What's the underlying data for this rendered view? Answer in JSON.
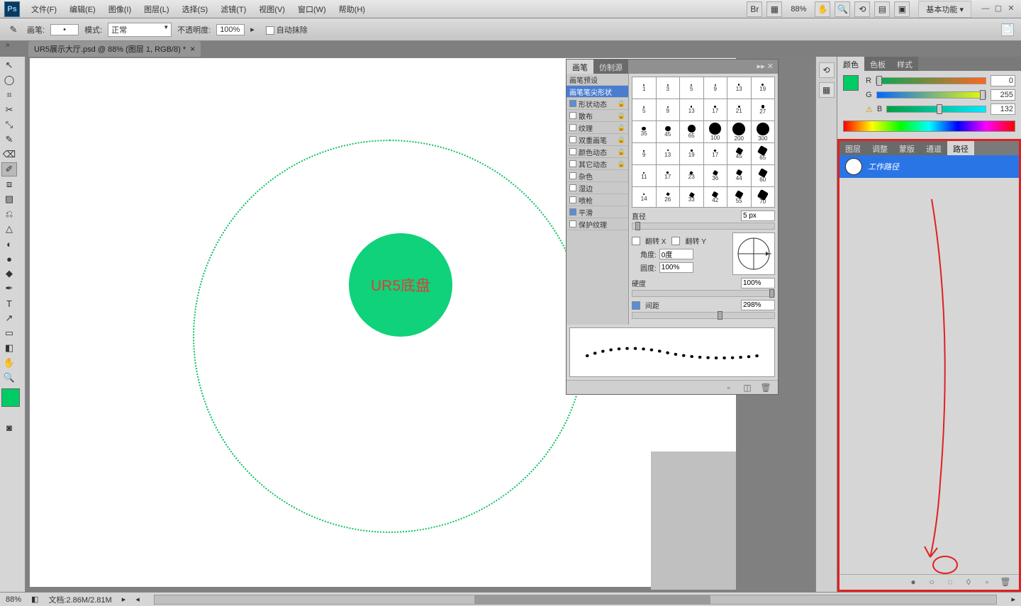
{
  "menubar": {
    "items": [
      "文件(F)",
      "编辑(E)",
      "图像(I)",
      "图层(L)",
      "选择(S)",
      "滤镜(T)",
      "视图(V)",
      "窗口(W)",
      "帮助(H)"
    ],
    "zoom": "88%",
    "workspace": "基本功能"
  },
  "options": {
    "brush_label": "画笔:",
    "mode_label": "模式:",
    "mode_value": "正常",
    "opacity_label": "不透明度:",
    "opacity_value": "100%",
    "auto_erase": "自动抹除"
  },
  "doc_tab": "UR5展示大厅.psd @ 88% (图层 1, RGB/8) *",
  "canvas": {
    "circle_text": "UR5底盘"
  },
  "color_panel": {
    "tabs": [
      "颜色",
      "色板",
      "样式"
    ],
    "r": "0",
    "g": "255",
    "b": "132"
  },
  "paths_panel": {
    "tabs": [
      "图层",
      "调整",
      "蒙版",
      "通道",
      "路径"
    ],
    "item": "工作路径"
  },
  "brush_panel": {
    "tabs": [
      "画笔",
      "仿制源"
    ],
    "section0": "画笔预设",
    "section1": "画笔笔尖形状",
    "opts": [
      "形状动态",
      "散布",
      "纹理",
      "双重画笔",
      "颜色动态",
      "其它动态",
      "杂色",
      "湿边",
      "喷枪",
      "平滑",
      "保护纹理"
    ],
    "tips": [
      1,
      3,
      5,
      9,
      13,
      19,
      5,
      9,
      13,
      17,
      21,
      27,
      35,
      45,
      65,
      100,
      200,
      300,
      9,
      13,
      19,
      17,
      45,
      65,
      11,
      17,
      23,
      36,
      44,
      60,
      14,
      26,
      33,
      42,
      55,
      70
    ],
    "diameter_label": "直径",
    "diameter_value": "5 px",
    "flip_x": "翻转 X",
    "flip_y": "翻转 Y",
    "angle_label": "角度:",
    "angle_value": "0度",
    "round_label": "圆度:",
    "round_value": "100%",
    "hardness_label": "硬度",
    "hardness_value": "100%",
    "spacing_label": "间距",
    "spacing_value": "298%"
  },
  "status": {
    "zoom": "88%",
    "doc_size": "文档:2.86M/2.81M"
  }
}
